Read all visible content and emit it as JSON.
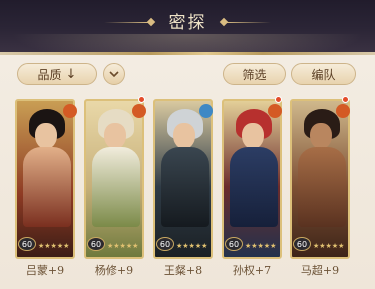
{
  "header": {
    "title": "密探"
  },
  "toolbar": {
    "quality_label": "品质",
    "quality_icon": "down-arrow-icon",
    "sort_icon": "chevron-down-icon",
    "filter_label": "筛选",
    "team_label": "编队"
  },
  "cards": [
    {
      "name": "吕蒙+9",
      "level": "60",
      "stars": "★★★★★",
      "badge": "fire",
      "bg": "#8e3a23"
    },
    {
      "name": "杨修+9",
      "level": "60",
      "stars": "★★★★★",
      "badge": "fire",
      "bg": "#c7b07a"
    },
    {
      "name": "王粲+8",
      "level": "60",
      "stars": "★★★★★",
      "badge": "water",
      "bg": "#2f3c47"
    },
    {
      "name": "孙权+7",
      "level": "60",
      "stars": "★★★★★",
      "badge": "fire",
      "bg": "#6c2c2c"
    },
    {
      "name": "马超+9",
      "level": "60",
      "stars": "★★★★★",
      "badge": "fire",
      "bg": "#7e5034"
    }
  ],
  "colors": {
    "accent": "#dcc07a",
    "panel": "#f1e9dd",
    "header": "#2b2536"
  }
}
